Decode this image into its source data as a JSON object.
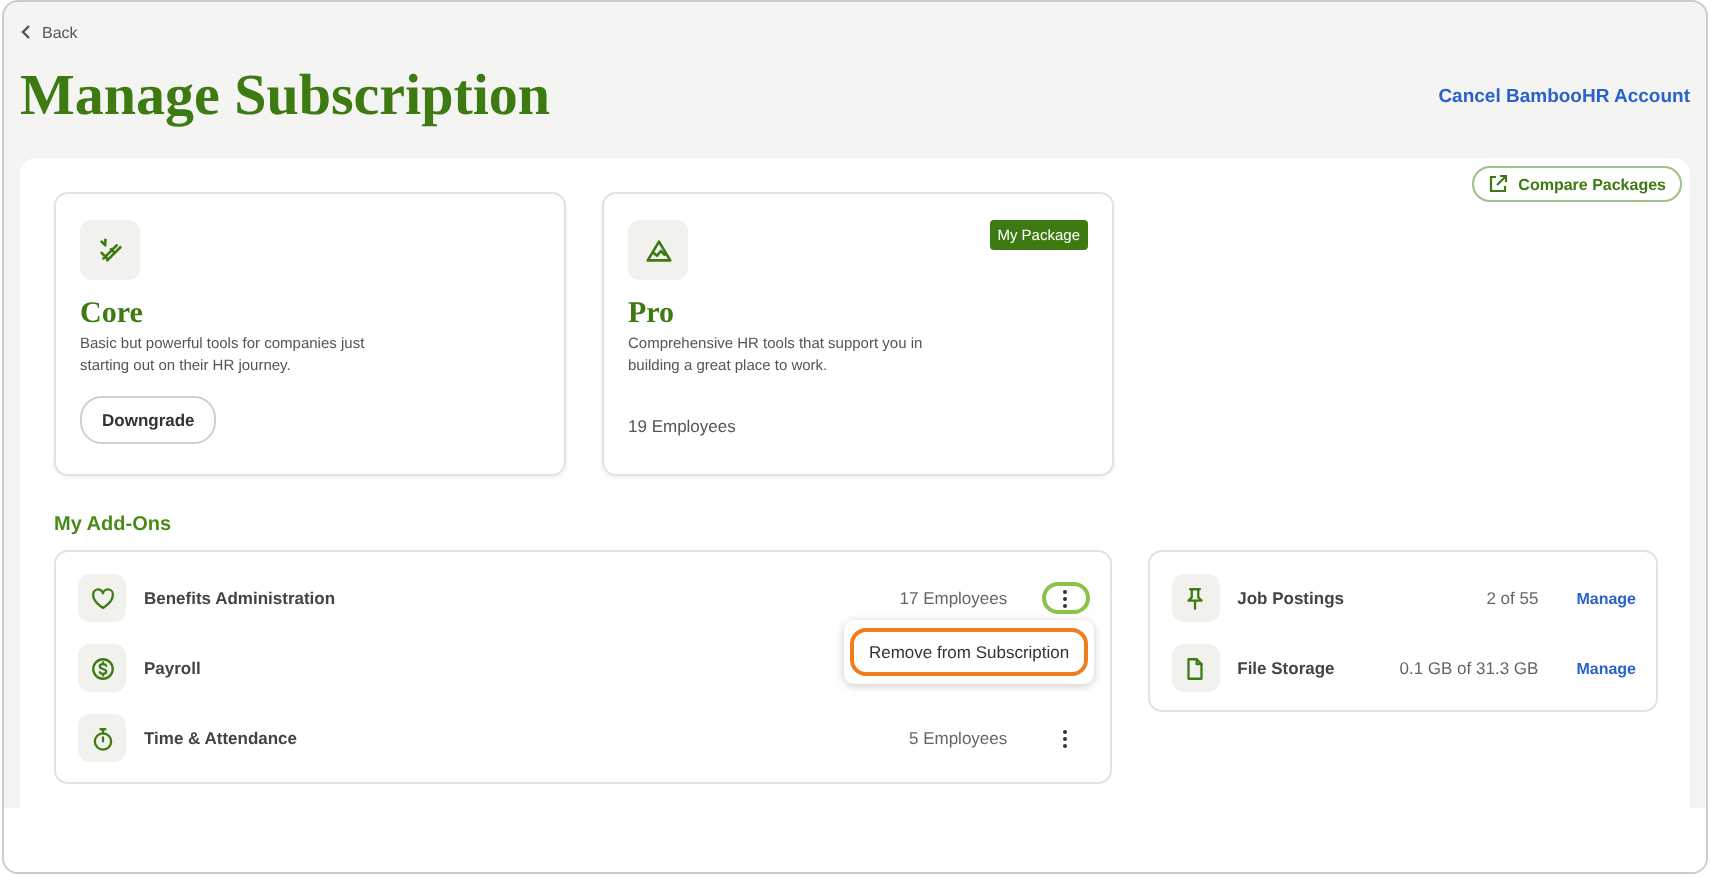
{
  "back": "Back",
  "title": "Manage Subscription",
  "cancel_link": "Cancel BambooHR Account",
  "compare_button": "Compare Packages",
  "packages": [
    {
      "kind": "core",
      "name": "Core",
      "description": "Basic but powerful tools for companies just starting out on their HR journey.",
      "action": "Downgrade",
      "current": false
    },
    {
      "kind": "pro",
      "name": "Pro",
      "description": "Comprehensive HR tools that support you in building a great place to work.",
      "employees": "19 Employees",
      "current": true,
      "badge": "My Package"
    }
  ],
  "addons_heading": "My Add-Ons",
  "addons": [
    {
      "kind": "heart",
      "name": "Benefits Administration",
      "employees": "17 Employees",
      "menu_open": true
    },
    {
      "kind": "dollar",
      "name": "Payroll"
    },
    {
      "kind": "stopwatch",
      "name": "Time & Attendance",
      "employees": "5 Employees",
      "menu_open": false
    }
  ],
  "menu": {
    "items": [
      {
        "label": "Remove from Subscription",
        "focused": true
      }
    ]
  },
  "usage": [
    {
      "kind": "pin",
      "name": "Job Postings",
      "amount": "2 of 55",
      "action": "Manage"
    },
    {
      "kind": "file",
      "name": "File Storage",
      "amount": "0.1 GB of 31.3 GB",
      "action": "Manage"
    }
  ]
}
